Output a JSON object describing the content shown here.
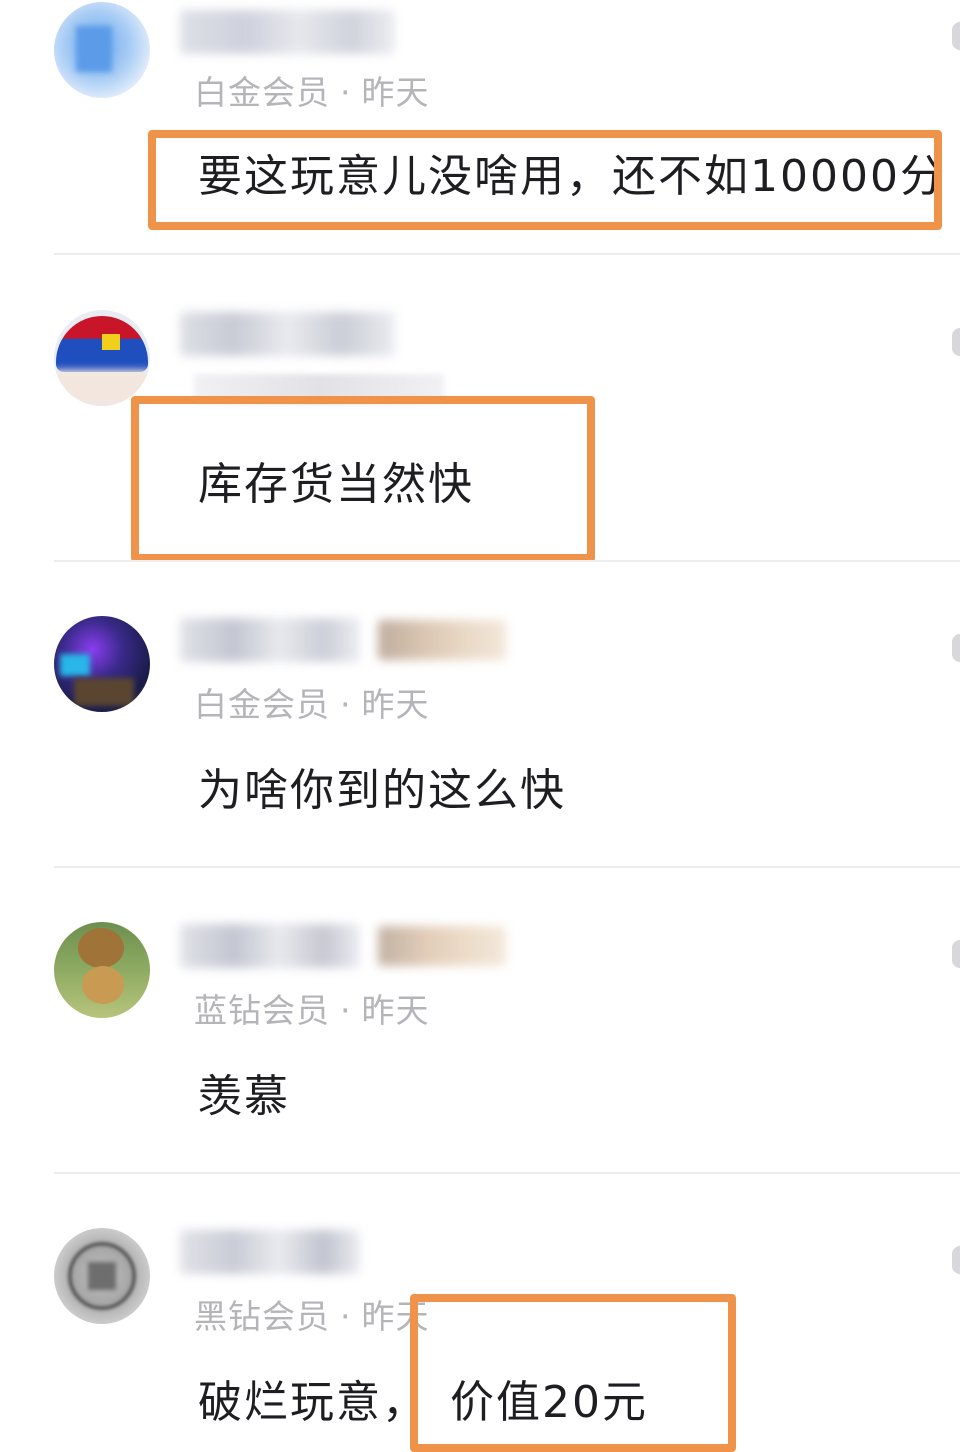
{
  "comments": [
    {
      "avatar": "blurred-avatar-blue",
      "member_level": "白金会员",
      "time": "昨天",
      "text": "要这玩意儿没啥用，还不如10000分"
    },
    {
      "avatar": "blurred-avatar-umbrella",
      "member_level": "",
      "time": "",
      "text": "库存货当然快"
    },
    {
      "avatar": "blurred-avatar-concert",
      "member_level": "白金会员",
      "time": "昨天",
      "text": "为啥你到的这么快"
    },
    {
      "avatar": "avatar-lions",
      "member_level": "蓝钻会员",
      "time": "昨天",
      "text": "羡慕"
    },
    {
      "avatar": "blurred-avatar-badge",
      "member_level": "黑钻会员",
      "time": "昨天",
      "text_part1": "破烂玩意，",
      "text_part2": "价值20元"
    }
  ],
  "separator": "·",
  "highlight_color": "#f0934a"
}
